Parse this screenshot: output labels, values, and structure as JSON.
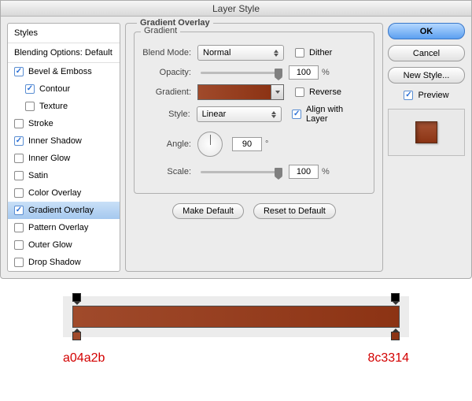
{
  "title": "Layer Style",
  "sidebar": {
    "header": "Styles",
    "blending": "Blending Options: Default",
    "items": [
      {
        "label": "Bevel & Emboss",
        "checked": true,
        "indent": false
      },
      {
        "label": "Contour",
        "checked": true,
        "indent": true
      },
      {
        "label": "Texture",
        "checked": false,
        "indent": true
      },
      {
        "label": "Stroke",
        "checked": false,
        "indent": false
      },
      {
        "label": "Inner Shadow",
        "checked": true,
        "indent": false
      },
      {
        "label": "Inner Glow",
        "checked": false,
        "indent": false
      },
      {
        "label": "Satin",
        "checked": false,
        "indent": false
      },
      {
        "label": "Color Overlay",
        "checked": false,
        "indent": false
      },
      {
        "label": "Gradient Overlay",
        "checked": true,
        "indent": false,
        "selected": true
      },
      {
        "label": "Pattern Overlay",
        "checked": false,
        "indent": false
      },
      {
        "label": "Outer Glow",
        "checked": false,
        "indent": false
      },
      {
        "label": "Drop Shadow",
        "checked": false,
        "indent": false
      }
    ]
  },
  "group_title": "Gradient Overlay",
  "inner_title": "Gradient",
  "labels": {
    "blend_mode": "Blend Mode:",
    "opacity": "Opacity:",
    "gradient": "Gradient:",
    "style": "Style:",
    "angle": "Angle:",
    "scale": "Scale:",
    "dither": "Dither",
    "reverse": "Reverse",
    "align": "Align with Layer",
    "pct": "%",
    "deg": "°"
  },
  "values": {
    "blend_mode": "Normal",
    "opacity": "100",
    "style": "Linear",
    "angle": "90",
    "scale": "100",
    "dither": false,
    "reverse": false,
    "align": true
  },
  "gradient": {
    "from": "#a04a2b",
    "to": "#8c3314"
  },
  "buttons": {
    "make_default": "Make Default",
    "reset": "Reset to Default",
    "ok": "OK",
    "cancel": "Cancel",
    "new_style": "New Style...",
    "preview": "Preview"
  },
  "hex_left": "a04a2b",
  "hex_right": "8c3314"
}
